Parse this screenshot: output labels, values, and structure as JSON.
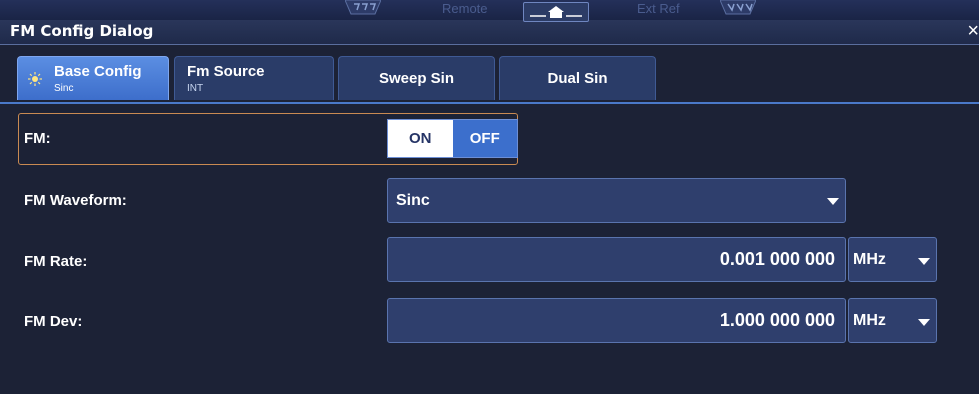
{
  "header": {
    "title": "FM Config Dialog",
    "status_remote": "Remote",
    "status_extref": "Ext Ref",
    "close_glyph": "×"
  },
  "tabs": [
    {
      "label": "Base Config",
      "sub": "Sinc",
      "active": true
    },
    {
      "label": "Fm Source",
      "sub": "INT",
      "active": false
    },
    {
      "label": "Sweep Sin",
      "sub": "",
      "active": false
    },
    {
      "label": "Dual Sin",
      "sub": "",
      "active": false
    }
  ],
  "form": {
    "fm": {
      "label": "FM:",
      "on_label": "ON",
      "off_label": "OFF",
      "selected": "OFF"
    },
    "waveform": {
      "label": "FM Waveform:",
      "value": "Sinc"
    },
    "rate": {
      "label": "FM Rate:",
      "value": "0.001 000 000",
      "unit": "MHz"
    },
    "dev": {
      "label": "FM Dev:",
      "value": "1.000 000 000",
      "unit": "MHz"
    }
  },
  "colors": {
    "background": "#1c2236",
    "accent": "#3c6fcc",
    "focus_border": "#c98a52"
  }
}
